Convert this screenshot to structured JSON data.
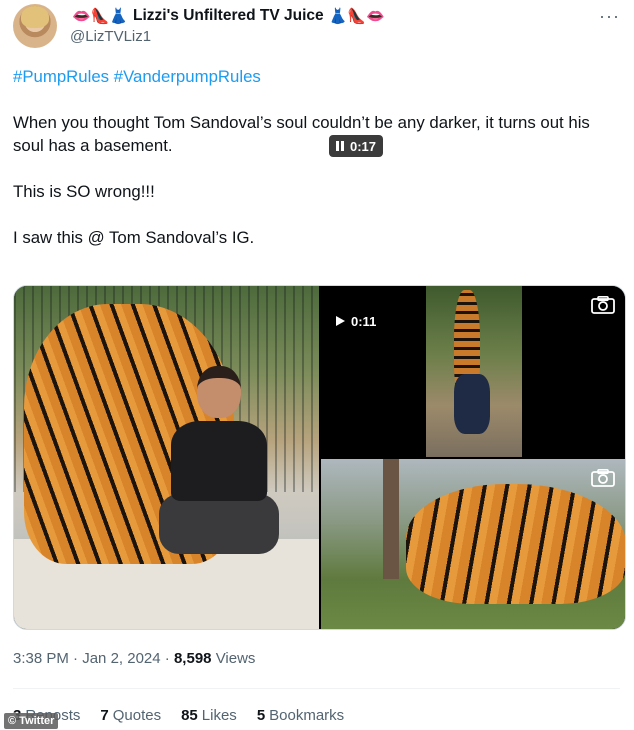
{
  "author": {
    "display_name": "Lizzi's Unfiltered TV Juice",
    "handle": "@LizTVLiz1",
    "name_emojis_left": "👄👠👗",
    "name_emojis_right": "👗👠👄"
  },
  "more_menu": "···",
  "tweet": {
    "hashtags": "#PumpRules #VanderpumpRules",
    "paragraphs": [
      "When you thought Tom Sandoval’s soul couldn’t be any darker, it turns out his soul has a basement.",
      "This is SO wrong!!!",
      "I saw this @ Tom Sandoval’s IG."
    ]
  },
  "media": {
    "video_top_duration": "0:17",
    "video_bottom_duration": "0:11",
    "icons": [
      "pause-icon",
      "play-icon",
      "camera-icon"
    ]
  },
  "meta": {
    "time": "3:38 PM",
    "date": "Jan 2, 2024",
    "views_count": "8,598",
    "views_label": "Views"
  },
  "stats": {
    "reposts_count": "3",
    "reposts_label": "Reposts",
    "quotes_count": "7",
    "quotes_label": "Quotes",
    "likes_count": "85",
    "likes_label": "Likes",
    "bookmarks_count": "5",
    "bookmarks_label": "Bookmarks"
  },
  "watermark": "© Twitter",
  "colors": {
    "link": "#1d9bf0",
    "secondary_text": "#536471",
    "primary_text": "#0f1419"
  }
}
